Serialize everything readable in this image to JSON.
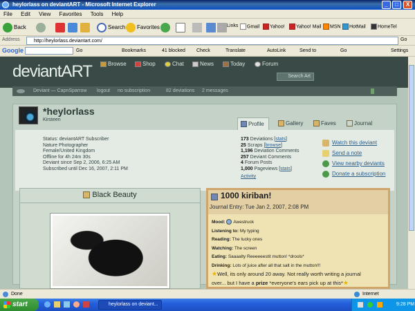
{
  "window": {
    "title": "heylorlass on deviantART - Microsoft Internet Explorer",
    "min": "_",
    "max": "□",
    "close": "X"
  },
  "menu": [
    "File",
    "Edit",
    "View",
    "Favorites",
    "Tools",
    "Help"
  ],
  "toolbar": {
    "back": "Back",
    "search": "Search",
    "favorites": "Favorites",
    "links_label": "Links",
    "links": [
      "Gmail",
      "Yahoo!",
      "Yahoo! Mail",
      "MSN",
      "HotMail",
      "HomeTel"
    ]
  },
  "address": {
    "label": "Address",
    "url": "http://heylorlass.deviantart.com/",
    "go": "Go"
  },
  "googlebar": {
    "logo": "Google",
    "go": "Go",
    "bookmarks": "Bookmarks",
    "blocked": "41 blocked",
    "check": "Check",
    "translate": "Translate",
    "autolink": "AutoLink",
    "sendto": "Send to",
    "go2": "Go",
    "settings": "Settings"
  },
  "da": {
    "logo": "deviantART",
    "nav": [
      "Browse",
      "Shop",
      "Chat",
      "News",
      "Today",
      "Forum"
    ],
    "search": "Search Art",
    "sub": {
      "user": "Deviant — CapnSparrow",
      "logout": "logout",
      "subscription": "no subscription",
      "deviations": "82 deviations",
      "messages": "2 messages"
    }
  },
  "profile": {
    "username": "*heylorlass",
    "realname": "Kirsteen",
    "tabs": [
      "Profile",
      "Gallery",
      "Faves",
      "Journal"
    ],
    "status": [
      "Status: deviantART Subscriber",
      "Nature Photographer",
      "Female/United Kingdom",
      "Offline for 4h 24m 30s",
      "Deviant since Sep 2, 2006, 6:25 AM",
      "Subscribed until Dec 16, 2007, 2:11 PM"
    ],
    "stats": [
      {
        "num": "173",
        "label": "Deviations",
        "link": "stats"
      },
      {
        "num": "25",
        "label": "Scraps",
        "link": "browse"
      },
      {
        "num": "1,196",
        "label": "Deviation Comments",
        "link": ""
      },
      {
        "num": "257",
        "label": "Deviant Comments",
        "link": ""
      },
      {
        "num": "4",
        "label": "Forum Posts",
        "link": ""
      },
      {
        "num": "1,000",
        "label": "Pageviews",
        "link": "stats"
      }
    ],
    "activity": "Activity",
    "actions": [
      "Watch this deviant",
      "Send a note",
      "View nearby deviants",
      "Donate a subscription"
    ]
  },
  "gallery": {
    "title": "Black Beauty"
  },
  "journal": {
    "title": "1000 kiriban!",
    "date": "Journal Entry: Tue Jan 2, 2007, 2:08 PM",
    "fields": [
      {
        "label": "Mood:",
        "value": "Awestruck"
      },
      {
        "label": "Listening to:",
        "value": "My typing"
      },
      {
        "label": "Reading:",
        "value": "The lucky ones"
      },
      {
        "label": "Watching:",
        "value": "The screen"
      },
      {
        "label": "Eating:",
        "value": "Saaaalty Reeeeeestit mutton! *drools*"
      },
      {
        "label": "Drinking:",
        "value": "Lots of juice after all that salt in the mutton!!!"
      }
    ],
    "text1": "Well, its only around 20 away. Not really worth writing a journal",
    "text2a": "over... but I have a",
    "text2b": "prize",
    "text2c": "*everyone's ears pick up at this*"
  },
  "statusbar": {
    "text": "Done",
    "zone": "Internet"
  },
  "taskbar": {
    "start": "start",
    "task": "heylorlass on deviant...",
    "clock": "9:28 PM"
  },
  "colors": {
    "da_header": "#3a4a47",
    "da_body": "#b3c4b8",
    "journal_bg": "#f0e3b3",
    "journal_border": "#cfa56a",
    "xp_blue": "#245edb"
  }
}
